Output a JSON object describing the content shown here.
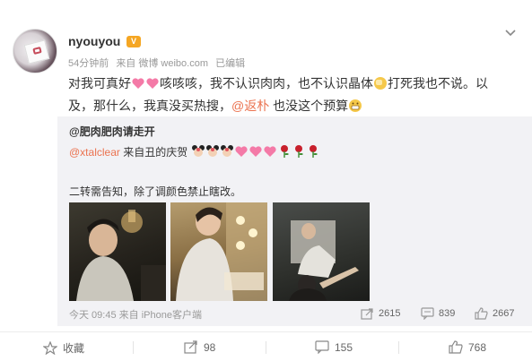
{
  "user": {
    "name": "nyouyou",
    "time": "54分钟前",
    "source": "来自 微博 weibo.com",
    "edited": "已编辑"
  },
  "post": {
    "line1_a": "对我可真好",
    "line1_b": "咳咳咳，我不认识肉肉，也不认识晶体",
    "line1_c": "打死我也不说。以",
    "line2_a": "及，那什么，我真没买热搜，",
    "mention": "@返朴",
    "line2_b": " 也没这个预算"
  },
  "repost": {
    "author": "@肥肉肥肉请走开",
    "mention": "@xtalclear",
    "line2_text": " 来自丑的庆贺",
    "line3": "二转需告知，除了调颜色禁止瞎改。",
    "footer_time": "今天 09:45 来自 iPhone客户端",
    "shares": "2615",
    "comments": "839",
    "likes": "2667"
  },
  "toolbar": {
    "favorite_label": "收藏",
    "share_count": "98",
    "comment_count": "155",
    "like_count": "768"
  },
  "colors": {
    "link": "#eb7350",
    "muted": "#999999",
    "repost_bg": "#f2f2f5",
    "heart": "#f47aa7"
  }
}
